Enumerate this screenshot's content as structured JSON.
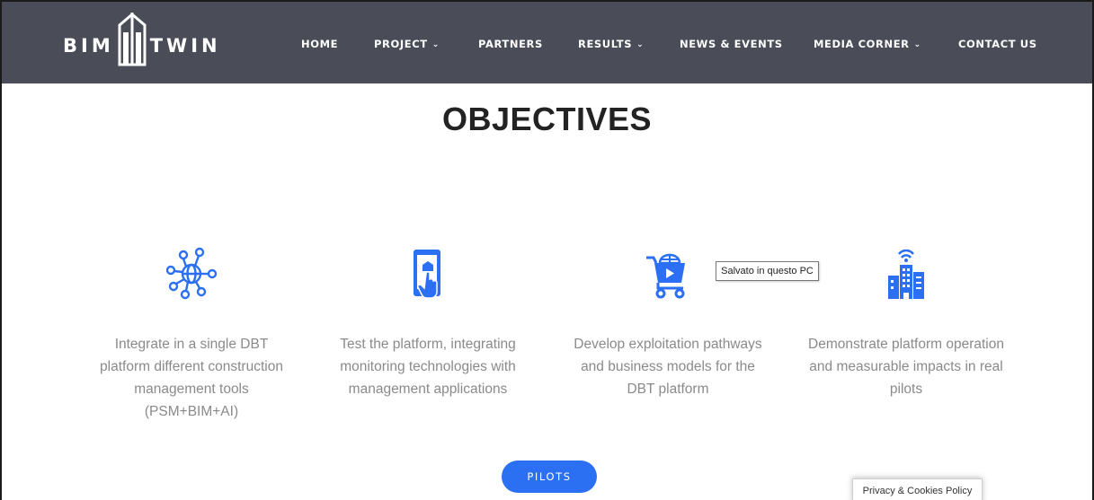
{
  "header": {
    "logo": {
      "left": "BIM",
      "right": "TWIN"
    },
    "nav": [
      {
        "label": "HOME",
        "dropdown": false
      },
      {
        "label": "PROJECT",
        "dropdown": true
      },
      {
        "label": "PARTNERS",
        "dropdown": false
      },
      {
        "label": "RESULTS",
        "dropdown": true
      },
      {
        "label": "NEWS & EVENTS",
        "dropdown": false
      },
      {
        "label": "MEDIA CORNER",
        "dropdown": true
      },
      {
        "label": "CONTACT US",
        "dropdown": false
      }
    ],
    "background_color": "#4a4d57"
  },
  "main": {
    "title": "OBJECTIVES",
    "objectives": [
      {
        "icon": "network-hub-icon",
        "text": "Integrate in a single DBT platform different construction management tools (PSM+BIM+AI)"
      },
      {
        "icon": "touchscreen-tablet-icon",
        "text": "Test the platform, integrating monitoring technologies with management applications"
      },
      {
        "icon": "shopping-cart-play-icon",
        "text": "Develop exploitation pathways and business models for the DBT platform"
      },
      {
        "icon": "smart-building-icon",
        "text": "Demonstrate platform operation and measurable impacts in real pilots"
      }
    ],
    "icon_color": "#2b6ff2",
    "pilots_button": "PILOTS"
  },
  "tooltip": "Salvato in questo PC",
  "privacy_badge": "Privacy & Cookies Policy"
}
